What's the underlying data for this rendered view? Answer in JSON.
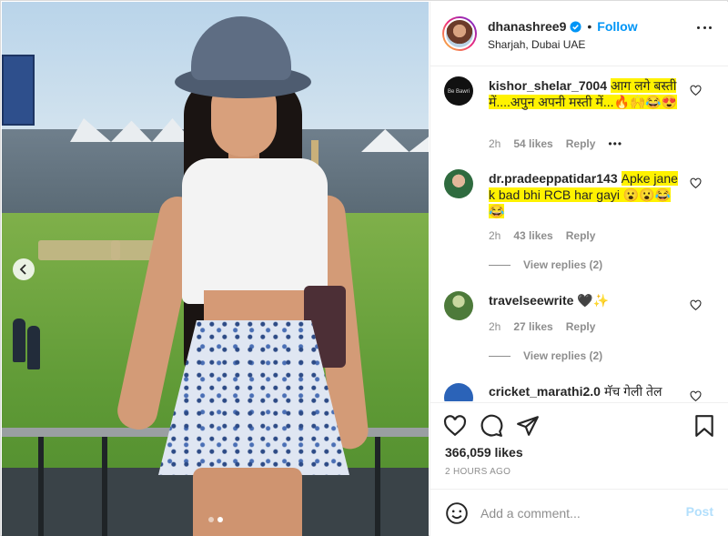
{
  "post": {
    "username": "dhanashree9",
    "separator": "•",
    "follow_label": "Follow",
    "location": "Sharjah, Dubai UAE",
    "carousel": {
      "slides": 2,
      "active_index": 1
    }
  },
  "comments": [
    {
      "username": "kishor_shelar_7004",
      "text": "आग लगे बस्ती में....अपुन अपनी मस्ती में...🔥🙌😂😍",
      "time": "2h",
      "likes": "54 likes",
      "reply_label": "Reply",
      "has_more_menu": true
    },
    {
      "username": "dr.pradeeppatidar143",
      "text": "Apke jane k bad bhi RCB har gayi 😮😮😂😂",
      "time": "2h",
      "likes": "43 likes",
      "reply_label": "Reply",
      "view_replies": "View replies (2)"
    },
    {
      "username": "travelseewrite",
      "text": "🖤✨",
      "time": "2h",
      "likes": "27 likes",
      "reply_label": "Reply",
      "view_replies": "View replies (2)"
    },
    {
      "username": "cricket_marathi2.0",
      "text": "मॅच गेली तेल"
    }
  ],
  "engagement": {
    "likes": "366,059 likes",
    "posted": "2 HOURS AGO"
  },
  "composer": {
    "placeholder": "Add a comment...",
    "post_label": "Post"
  },
  "colors": {
    "link_blue": "#0095f6",
    "highlight": "#fff200",
    "post_disabled": "#b2dffc",
    "muted": "#8e8e8e"
  }
}
